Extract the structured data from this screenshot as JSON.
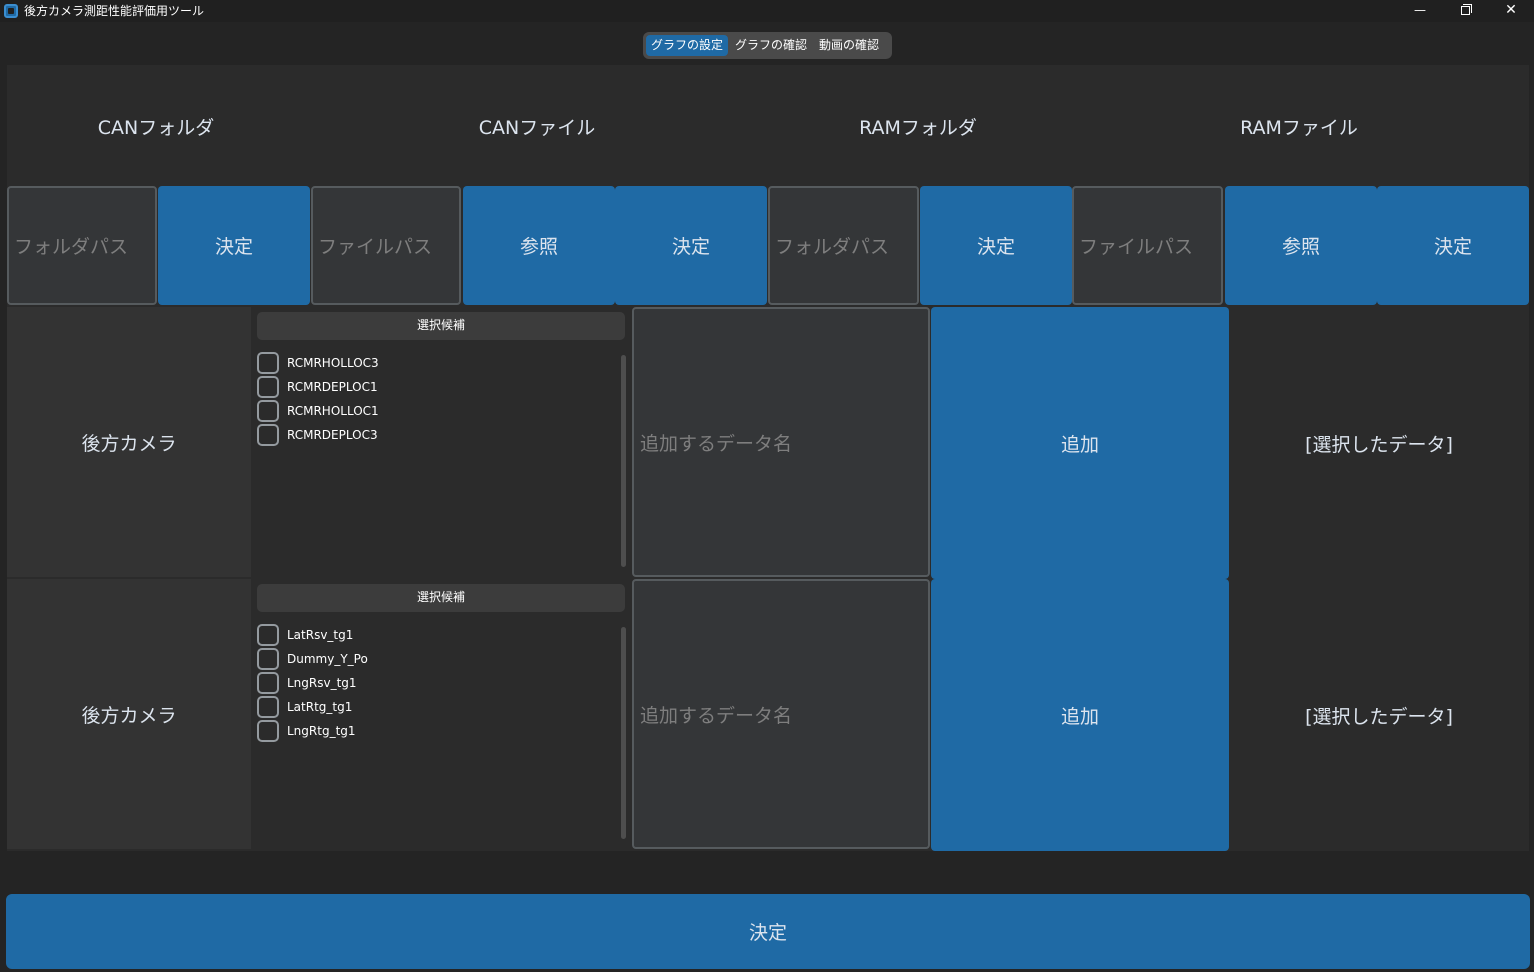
{
  "window": {
    "title": "後方カメラ測距性能評価用ツール",
    "minimize": "—",
    "close": "✕"
  },
  "tabs": [
    {
      "label": "グラフの設定",
      "active": true
    },
    {
      "label": "グラフの確認",
      "active": false
    },
    {
      "label": "動画の確認",
      "active": false
    }
  ],
  "sections": {
    "can_folder": "CANフォルダ",
    "can_file": "CANファイル",
    "ram_folder": "RAMフォルダ",
    "ram_file": "RAMファイル"
  },
  "inputs": {
    "can_folder_placeholder": "フォルダパス",
    "can_file_placeholder": "ファイルパス",
    "ram_folder_placeholder": "フォルダパス",
    "ram_file_placeholder": "ファイルパス"
  },
  "buttons": {
    "decide": "決定",
    "browse": "参照",
    "add": "追加",
    "final": "決定"
  },
  "rows": [
    {
      "label": "後方カメラ",
      "candidates_title": "選択候補",
      "candidates": [
        "RCMRHOLLOC3",
        "RCMRDEPLOC1",
        "RCMRHOLLOC1",
        "RCMRDEPLOC3"
      ],
      "name_placeholder": "追加するデータ名",
      "add_label": "追加",
      "selected_text": "[選択したデータ]"
    },
    {
      "label": "後方カメラ",
      "candidates_title": "選択候補",
      "candidates": [
        "LatRsv_tg1",
        "Dummy_Y_Po",
        "LngRsv_tg1",
        "LatRtg_tg1",
        "LngRtg_tg1"
      ],
      "name_placeholder": "追加するデータ名",
      "add_label": "追加",
      "selected_text": "[選択したデータ]"
    }
  ],
  "colors": {
    "accent": "#1f6aa5",
    "background": "#242424",
    "panel": "#2b2b2b",
    "entry": "#343638"
  }
}
